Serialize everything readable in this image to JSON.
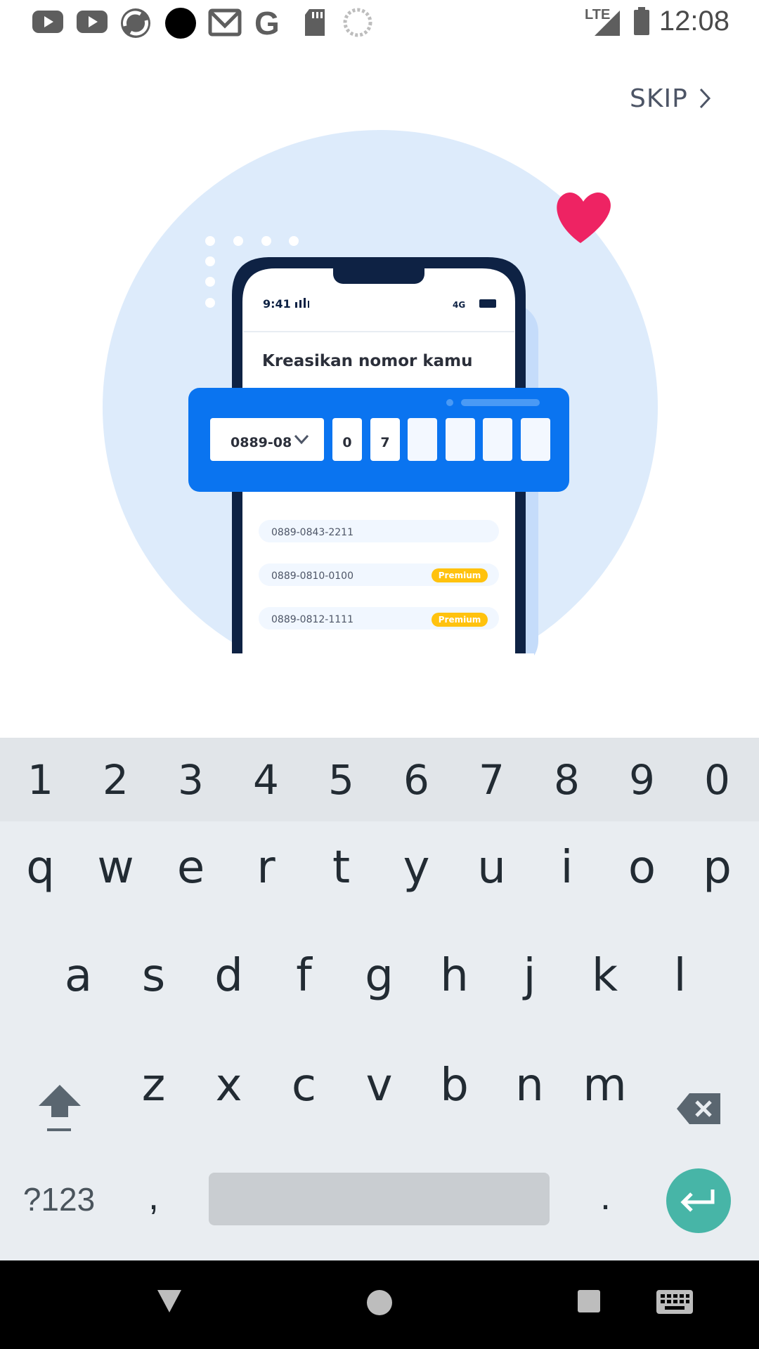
{
  "status_bar": {
    "time": "12:08",
    "network": "LTE",
    "icons": [
      "youtube-icon",
      "youtube-icon",
      "app-icon",
      "circle-icon",
      "gmail-icon",
      "google-icon",
      "sd-card-icon",
      "loading-icon",
      "signal-icon",
      "battery-icon"
    ]
  },
  "skip": {
    "label": "SKIP"
  },
  "illustration": {
    "phone_time": "9:41",
    "phone_title": "Kreasikan nomor kamu",
    "prefix_value": "0889-08",
    "digits": [
      "0",
      "7",
      "",
      "",
      "",
      ""
    ],
    "numbers": [
      {
        "number": "0889-0843-2211",
        "badge": ""
      },
      {
        "number": "0889-0810-0100",
        "badge": "Premium"
      },
      {
        "number": "0889-0812-1111",
        "badge": "Premium"
      }
    ],
    "colors": {
      "circle": "#ddebfb",
      "panel": "#0a74f0",
      "badge": "#ffc20e",
      "heart": "#ee2363",
      "phone_frame": "#0e2244"
    }
  },
  "keyboard": {
    "numbers": [
      "1",
      "2",
      "3",
      "4",
      "5",
      "6",
      "7",
      "8",
      "9",
      "0"
    ],
    "row1": [
      "q",
      "w",
      "e",
      "r",
      "t",
      "y",
      "u",
      "i",
      "o",
      "p"
    ],
    "row2": [
      "a",
      "s",
      "d",
      "f",
      "g",
      "h",
      "j",
      "k",
      "l"
    ],
    "row3": [
      "z",
      "x",
      "c",
      "v",
      "b",
      "n",
      "m"
    ],
    "symbols_label": "?123",
    "comma": ",",
    "period": ".",
    "enter_color": "#47b5a7"
  },
  "nav_bar": {
    "icons": [
      "back-icon",
      "home-icon",
      "recents-icon",
      "keyboard-switch-icon"
    ]
  }
}
